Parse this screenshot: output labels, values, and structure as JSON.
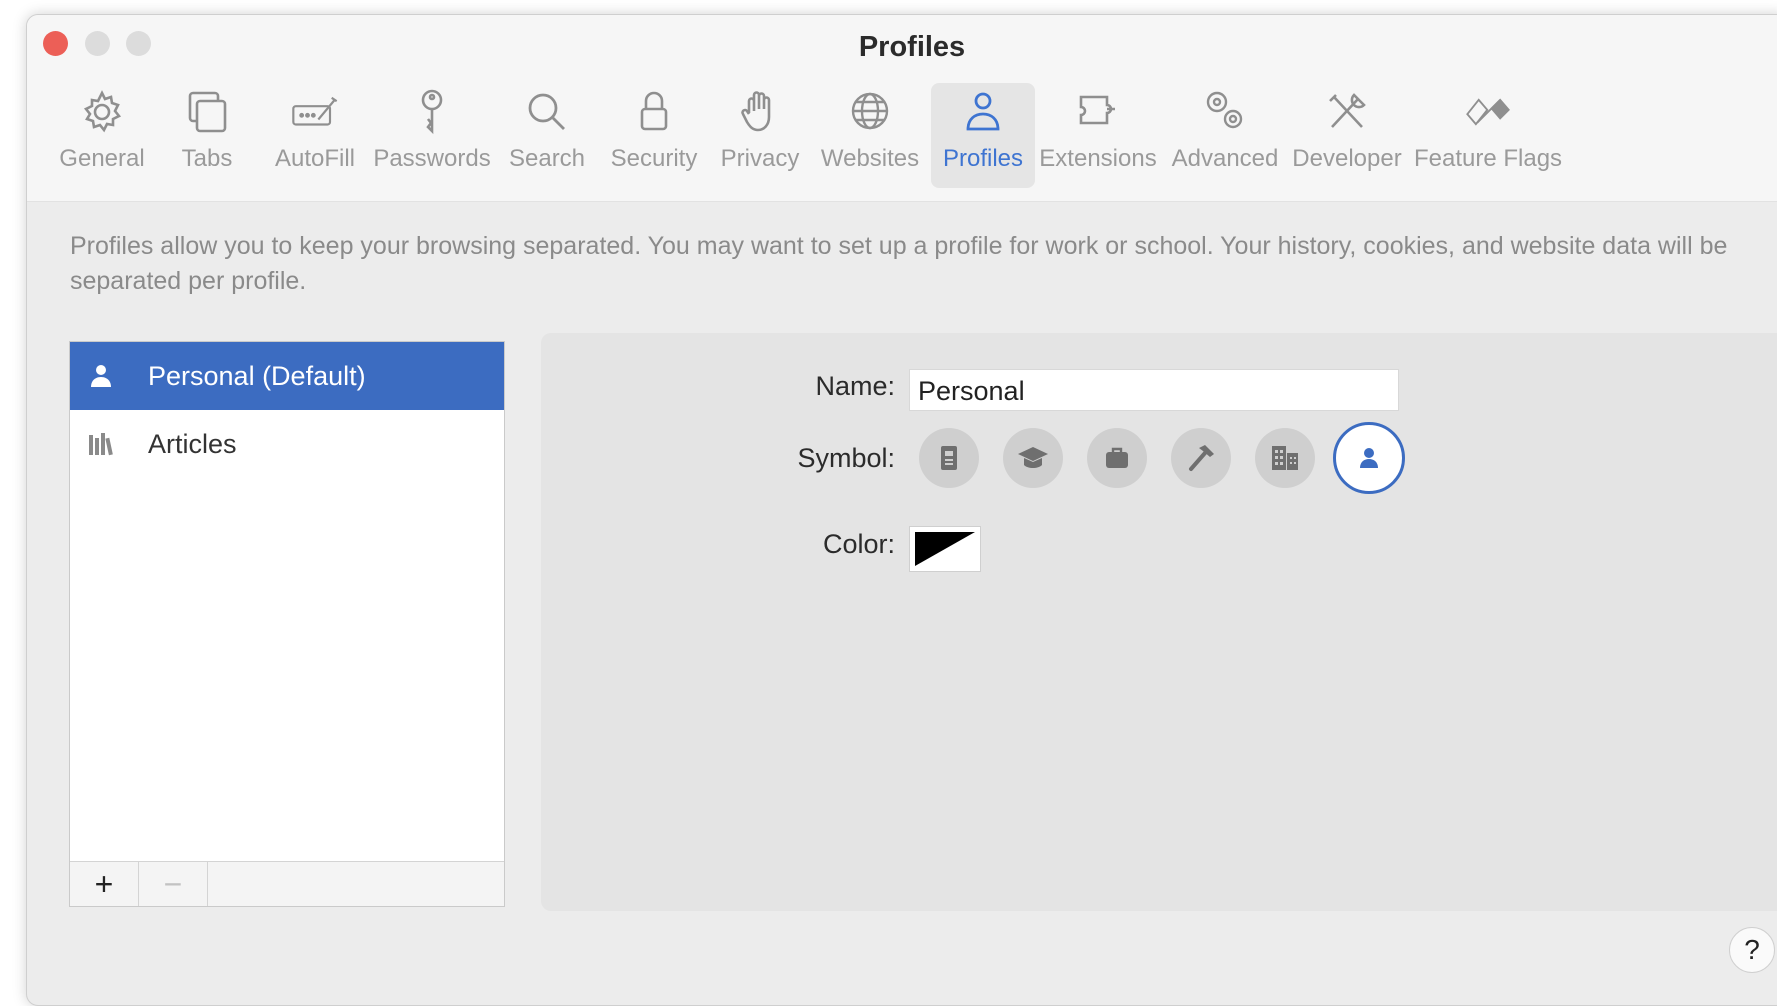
{
  "window": {
    "title": "Profiles"
  },
  "toolbar": {
    "items": [
      {
        "label": "General",
        "icon": "gear-icon"
      },
      {
        "label": "Tabs",
        "icon": "tabs-icon"
      },
      {
        "label": "AutoFill",
        "icon": "autofill-icon"
      },
      {
        "label": "Passwords",
        "icon": "key-icon"
      },
      {
        "label": "Search",
        "icon": "magnifier-icon"
      },
      {
        "label": "Security",
        "icon": "lock-icon"
      },
      {
        "label": "Privacy",
        "icon": "hand-icon"
      },
      {
        "label": "Websites",
        "icon": "globe-icon"
      },
      {
        "label": "Profiles",
        "icon": "person-icon"
      },
      {
        "label": "Extensions",
        "icon": "puzzle-icon"
      },
      {
        "label": "Advanced",
        "icon": "gears-icon"
      },
      {
        "label": "Developer",
        "icon": "tools-icon"
      },
      {
        "label": "Feature Flags",
        "icon": "flags-icon"
      }
    ],
    "active": "Profiles",
    "accent_color": "#3e74d1"
  },
  "description": "Profiles allow you to keep your browsing separated. You may want to set up a profile for work or school. Your history, cookies, and website data will be separated per profile.",
  "profiles_list": {
    "items": [
      {
        "label": "Personal (Default)",
        "icon": "person-icon",
        "selected": true
      },
      {
        "label": "Articles",
        "icon": "books-icon",
        "selected": false
      }
    ],
    "add_label": "+",
    "remove_label": "−"
  },
  "detail": {
    "name_label": "Name:",
    "name_value": "Personal",
    "symbol_label": "Symbol:",
    "symbols": [
      {
        "icon": "id-badge-icon",
        "selected": false
      },
      {
        "icon": "graduation-cap-icon",
        "selected": false
      },
      {
        "icon": "briefcase-icon",
        "selected": false
      },
      {
        "icon": "hammer-icon",
        "selected": false
      },
      {
        "icon": "building-icon",
        "selected": false
      },
      {
        "icon": "person-icon",
        "selected": true
      }
    ],
    "color_label": "Color:"
  },
  "help_label": "?"
}
